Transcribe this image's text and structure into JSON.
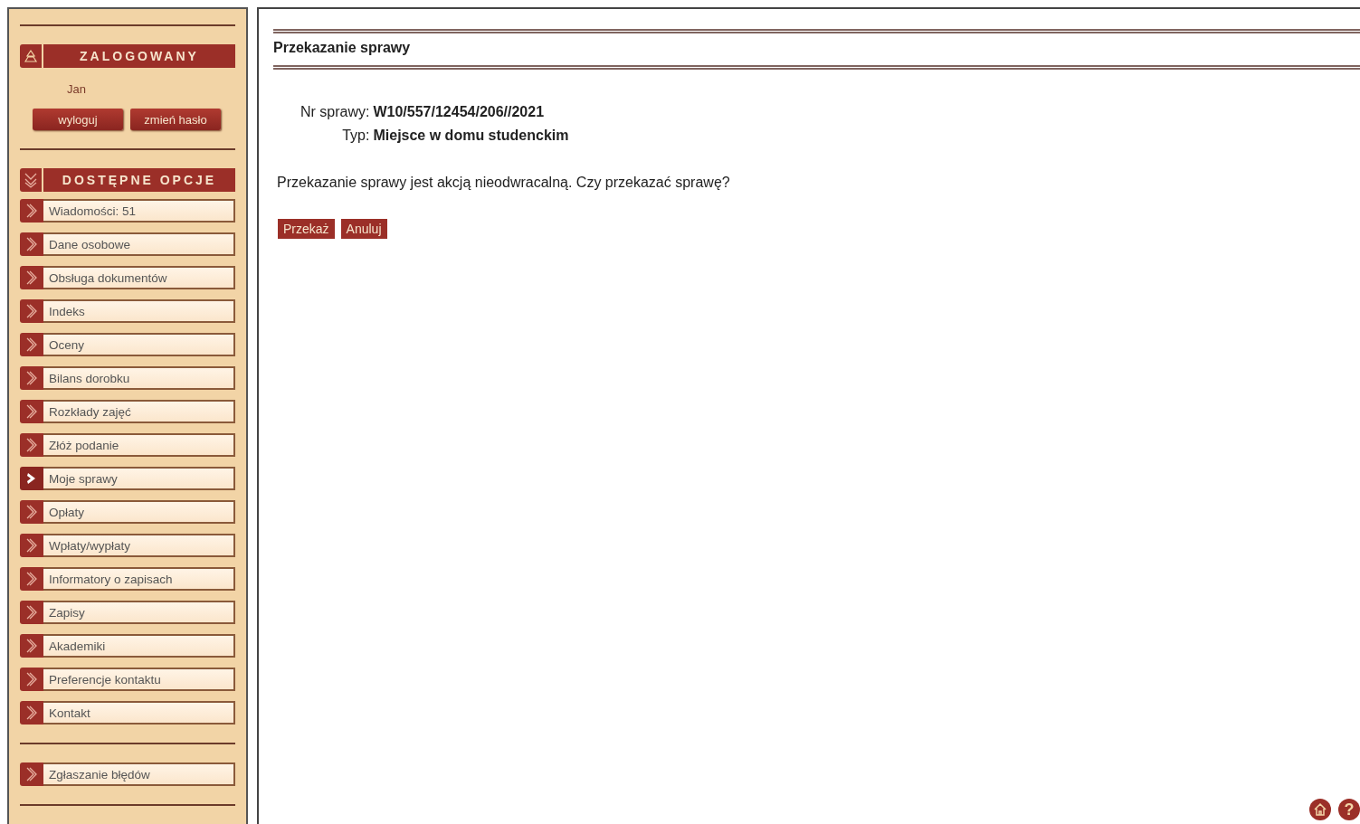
{
  "sidebar": {
    "login_header": "ZALOGOWANY",
    "user": "Jan",
    "buttons": [
      "wyloguj",
      "zmień hasło"
    ],
    "options_header": "DOSTĘPNE OPCJE",
    "items": [
      {
        "label": "Wiadomości: 51",
        "selected": false
      },
      {
        "label": "Dane osobowe",
        "selected": false
      },
      {
        "label": "Obsługa dokumentów",
        "selected": false
      },
      {
        "label": "Indeks",
        "selected": false
      },
      {
        "label": "Oceny",
        "selected": false
      },
      {
        "label": "Bilans dorobku",
        "selected": false
      },
      {
        "label": "Rozkłady zajęć",
        "selected": false
      },
      {
        "label": "Złóż podanie",
        "selected": false
      },
      {
        "label": "Moje sprawy",
        "selected": true
      },
      {
        "label": "Opłaty",
        "selected": false
      },
      {
        "label": "Wpłaty/wypłaty",
        "selected": false
      },
      {
        "label": "Informatory o zapisach",
        "selected": false
      },
      {
        "label": "Zapisy",
        "selected": false
      },
      {
        "label": "Akademiki",
        "selected": false
      },
      {
        "label": "Preferencje kontaktu",
        "selected": false
      },
      {
        "label": "Kontakt",
        "selected": false
      }
    ],
    "footer_items": [
      {
        "label": "Zgłaszanie błędów",
        "selected": false
      }
    ]
  },
  "main": {
    "title": "Przekazanie sprawy",
    "details": [
      {
        "label": "Nr sprawy:",
        "value": "W10/557/12454/206//2021"
      },
      {
        "label": "Typ:",
        "value": "Miejsce w domu studenckim"
      }
    ],
    "message": "Przekazanie sprawy jest akcją nieodwracalną. Czy przekazać sprawę?",
    "buttons": [
      "Przekaż",
      "Anuluj"
    ],
    "help_label": "?"
  }
}
